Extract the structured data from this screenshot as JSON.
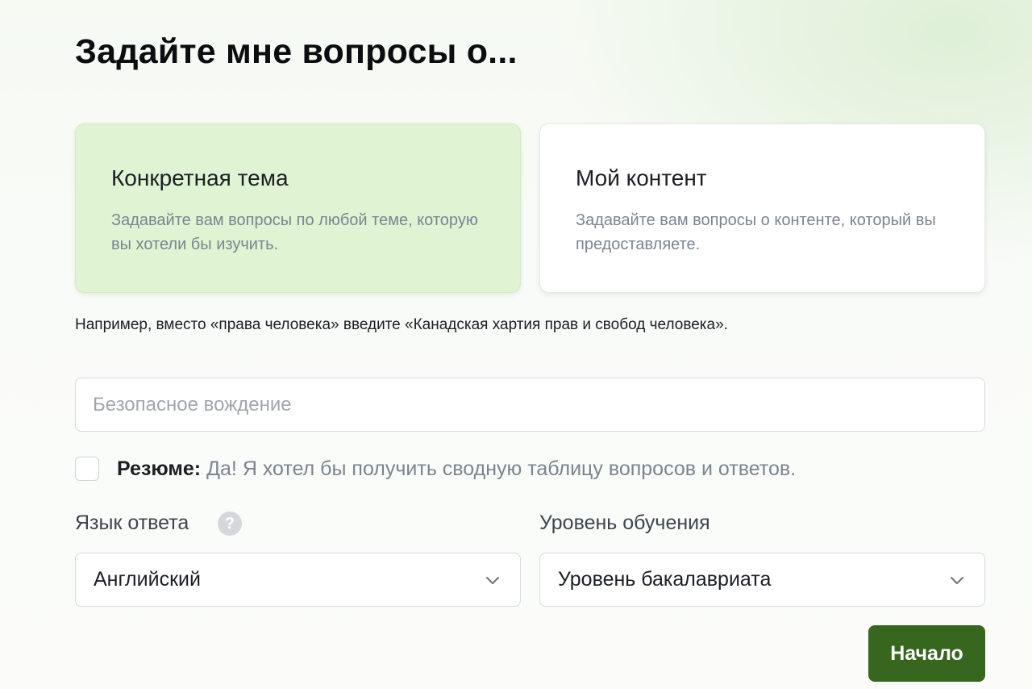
{
  "page": {
    "title": "Задайте мне вопросы о..."
  },
  "cards": {
    "topic": {
      "title": "Конкретная тема",
      "description": "Задавайте вам вопросы по любой теме, которую вы хотели бы изучить.",
      "selected": true
    },
    "content": {
      "title": "Мой контент",
      "description": "Задавайте вам вопросы о контенте, который вы предоставляете.",
      "selected": false
    }
  },
  "hint": "Например, вместо «права человека» введите «Канадская хартия прав и свобод человека».",
  "topic_input": {
    "value": "",
    "placeholder": "Безопасное вождение"
  },
  "summary": {
    "label": "Резюме:",
    "text": "Да! Я хотел бы получить сводную таблицу вопросов и ответов.",
    "checked": false
  },
  "language": {
    "label": "Язык ответа",
    "help_icon": "?",
    "value": "Английский"
  },
  "level": {
    "label": "Уровень обучения",
    "value": "Уровень бакалавриата"
  },
  "start_button": {
    "label": "Начало"
  },
  "colors": {
    "selected_card_bg": "#e0f3d3",
    "primary_button": "#37661e",
    "muted_text": "#7b8490"
  },
  "icons": {
    "help": "question-circle-icon",
    "dropdown": "chevron-down-icon"
  }
}
